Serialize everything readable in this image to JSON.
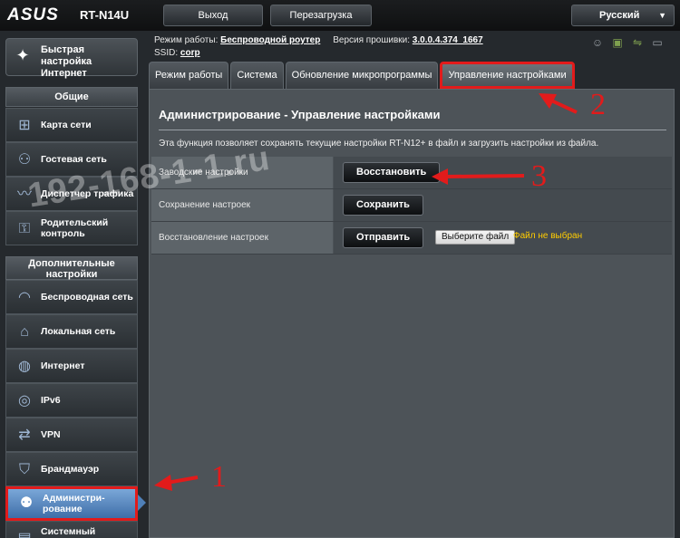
{
  "header": {
    "brand": "ASUS",
    "model": "RT-N14U",
    "logout_label": "Выход",
    "reboot_label": "Перезагрузка",
    "language": "Русский"
  },
  "status": {
    "mode_label": "Режим работы:",
    "mode_value": "Беспроводной роутер",
    "firmware_label": "Версия прошивки:",
    "firmware_value": "3.0.0.4.374_1667",
    "ssid_label": "SSID:",
    "ssid_value": "corp",
    "icons": [
      "usb-icon",
      "network-icon",
      "usb-drive-icon",
      "person-icon"
    ]
  },
  "sidebar": {
    "quick_setup": "Быстрая настройка Интернет",
    "general_title": "Общие",
    "general_items": [
      {
        "label": "Карта сети",
        "icon": "network-map-icon"
      },
      {
        "label": "Гостевая сеть",
        "icon": "guest-network-icon"
      },
      {
        "label": "Диспетчер трафика",
        "icon": "traffic-manager-icon"
      },
      {
        "label": "Родительский контроль",
        "icon": "parental-control-icon"
      }
    ],
    "advanced_title": "Дополнительные настройки",
    "advanced_items": [
      {
        "label": "Беспроводная сеть",
        "icon": "wireless-icon"
      },
      {
        "label": "Локальная сеть",
        "icon": "lan-icon"
      },
      {
        "label": "Интернет",
        "icon": "globe-icon"
      },
      {
        "label": "IPv6",
        "icon": "ipv6-icon"
      },
      {
        "label": "VPN",
        "icon": "vpn-icon"
      },
      {
        "label": "Брандмауэр",
        "icon": "firewall-icon"
      },
      {
        "label": "Администри-рование",
        "icon": "administration-icon"
      },
      {
        "label": "Системный",
        "icon": "system-log-icon"
      }
    ]
  },
  "tabs": [
    {
      "label": "Режим работы"
    },
    {
      "label": "Система"
    },
    {
      "label": "Обновление микропрограммы"
    },
    {
      "label": "Управление настройками"
    }
  ],
  "panel": {
    "title": "Администрирование - Управление настройками",
    "description": "Эта функция позволяет сохранять текущие настройки RT-N12+ в файл и загрузить настройки из файла.",
    "rows": [
      {
        "label": "Заводские настройки",
        "button": "Восстановить"
      },
      {
        "label": "Сохранение настроек",
        "button": "Сохранить"
      },
      {
        "label": "Восстановление настроек",
        "button": "Отправить",
        "file_button": "Выберите файл",
        "file_status": "Файл не выбран"
      }
    ]
  },
  "annotations": {
    "watermark": "192-168-1-1.ru",
    "steps": [
      "1",
      "2",
      "3"
    ],
    "color": "#e21b1b"
  }
}
